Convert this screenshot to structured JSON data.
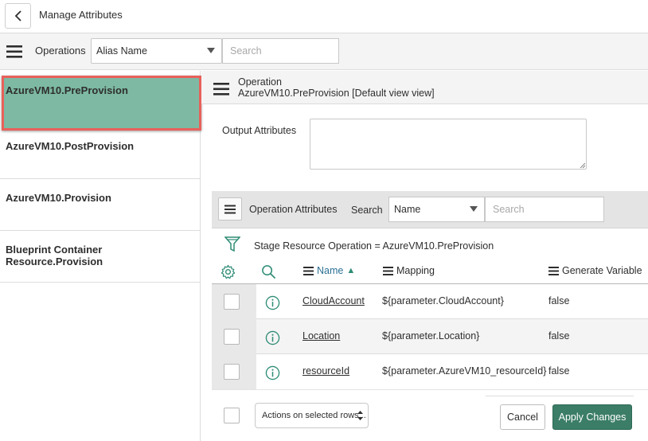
{
  "header": {
    "title": "Manage Attributes",
    "back_icon": "chevron-left-icon"
  },
  "operations_bar": {
    "label": "Operations",
    "select_value": "Alias Name",
    "search_placeholder": "Search"
  },
  "operations_list": {
    "selected_index": 0,
    "items": [
      {
        "label": "AzureVM10.PreProvision"
      },
      {
        "label": "AzureVM10.PostProvision"
      },
      {
        "label": "AzureVM10.Provision"
      },
      {
        "label": "Blueprint Container Resource.Provision"
      }
    ]
  },
  "operation_detail": {
    "title": "Operation",
    "subtitle": "AzureVM10.PreProvision [Default view view]",
    "output_attributes_label": "Output Attributes",
    "output_attributes_value": ""
  },
  "attributes": {
    "label": "Operation Attributes",
    "search_label": "Search",
    "select_value": "Name",
    "search_placeholder": "Search",
    "filter_text": "Stage Resource Operation = AzureVM10.PreProvision",
    "columns": {
      "name": "Name",
      "mapping": "Mapping",
      "generate_variable": "Generate Variable"
    },
    "sort_indicator": "▲",
    "rows": [
      {
        "name": "CloudAccount",
        "mapping": "${parameter.CloudAccount}",
        "generate_variable": "false"
      },
      {
        "name": "Location",
        "mapping": "${parameter.Location}",
        "generate_variable": "false"
      },
      {
        "name": "resourceId",
        "mapping": "${parameter.AzureVM10_resourceId}",
        "generate_variable": "false"
      }
    ]
  },
  "footer": {
    "actions_label": "Actions on selected rows...",
    "cancel_label": "Cancel",
    "apply_label": "Apply Changes"
  },
  "colors": {
    "selected_item_bg": "#7db9a3",
    "highlight_border": "#e8615a",
    "apply_button": "#3b7d66",
    "link_column": "#2a6f94",
    "icon_teal": "#2e8c75"
  }
}
